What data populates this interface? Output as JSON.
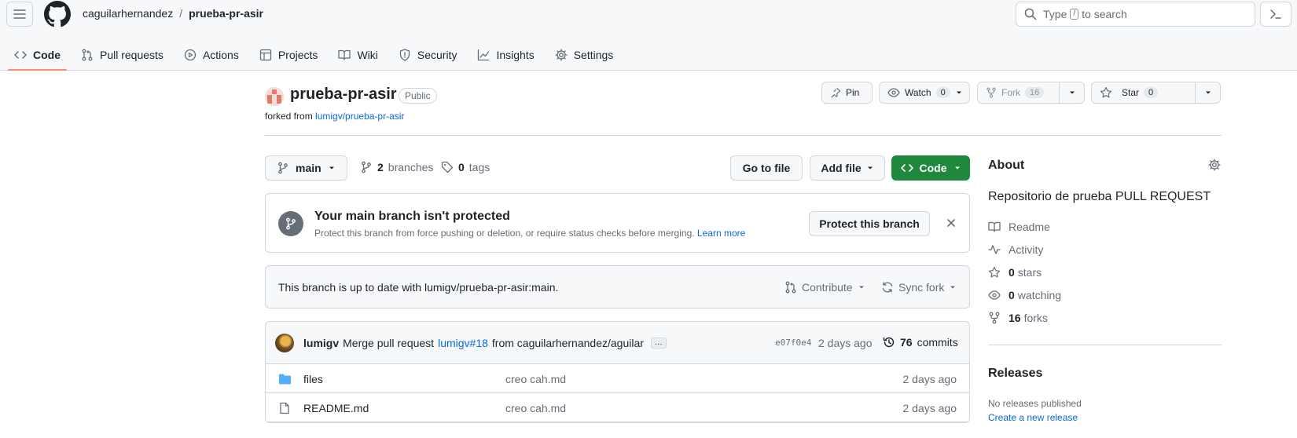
{
  "header": {
    "owner": "caguilarhernandez",
    "separator": "/",
    "repo": "prueba-pr-asir",
    "search_pre": "Type",
    "search_key": "/",
    "search_post": "to search"
  },
  "tabs": [
    {
      "label": "Code",
      "icon": "code-icon"
    },
    {
      "label": "Pull requests",
      "icon": "pull-request-icon"
    },
    {
      "label": "Actions",
      "icon": "play-icon"
    },
    {
      "label": "Projects",
      "icon": "table-icon"
    },
    {
      "label": "Wiki",
      "icon": "book-icon"
    },
    {
      "label": "Security",
      "icon": "shield-icon"
    },
    {
      "label": "Insights",
      "icon": "graph-icon"
    },
    {
      "label": "Settings",
      "icon": "gear-icon"
    }
  ],
  "repo_header": {
    "name": "prueba-pr-asir",
    "visibility": "Public",
    "forked_prefix": "forked from",
    "forked_source": "lumigv/prueba-pr-asir",
    "pin_label": "Pin",
    "watch_label": "Watch",
    "watch_count": "0",
    "fork_label": "Fork",
    "fork_count": "16",
    "star_label": "Star",
    "star_count": "0"
  },
  "branch_bar": {
    "branch": "main",
    "branches_count": "2",
    "branches_label": "branches",
    "tags_count": "0",
    "tags_label": "tags",
    "go_to_file": "Go to file",
    "add_file": "Add file",
    "code": "Code"
  },
  "protect": {
    "title": "Your main branch isn't protected",
    "description": "Protect this branch from force pushing or deletion, or require status checks before merging.",
    "learn_more": "Learn more",
    "button": "Protect this branch"
  },
  "sync": {
    "status": "This branch is up to date with lumigv/prueba-pr-asir:main.",
    "contribute": "Contribute",
    "sync_fork": "Sync fork"
  },
  "commit": {
    "author": "lumigv",
    "message_pre": "Merge pull request",
    "pr_link": "lumigv#18",
    "message_post": "from caguilarhernandez/aguilar",
    "ellipsis": "…",
    "sha": "e07f0e4",
    "date": "2 days ago",
    "count": "76",
    "count_label": "commits"
  },
  "files": [
    {
      "name": "files",
      "type": "folder",
      "message": "creo cah.md",
      "date": "2 days ago"
    },
    {
      "name": "README.md",
      "type": "file",
      "message": "creo cah.md",
      "date": "2 days ago"
    }
  ],
  "about": {
    "title": "About",
    "description": "Repositorio de prueba PULL REQUEST",
    "readme": "Readme",
    "activity": "Activity",
    "stars_count": "0",
    "stars_label": "stars",
    "watching_count": "0",
    "watching_label": "watching",
    "forks_count": "16",
    "forks_label": "forks"
  },
  "releases": {
    "title": "Releases",
    "none": "No releases published",
    "create": "Create a new release"
  },
  "colors": {
    "primary_green": "#1f883d",
    "link_blue": "#0969da",
    "active_tab_underline": "#fd8c73",
    "folder_blue": "#54aeff"
  }
}
